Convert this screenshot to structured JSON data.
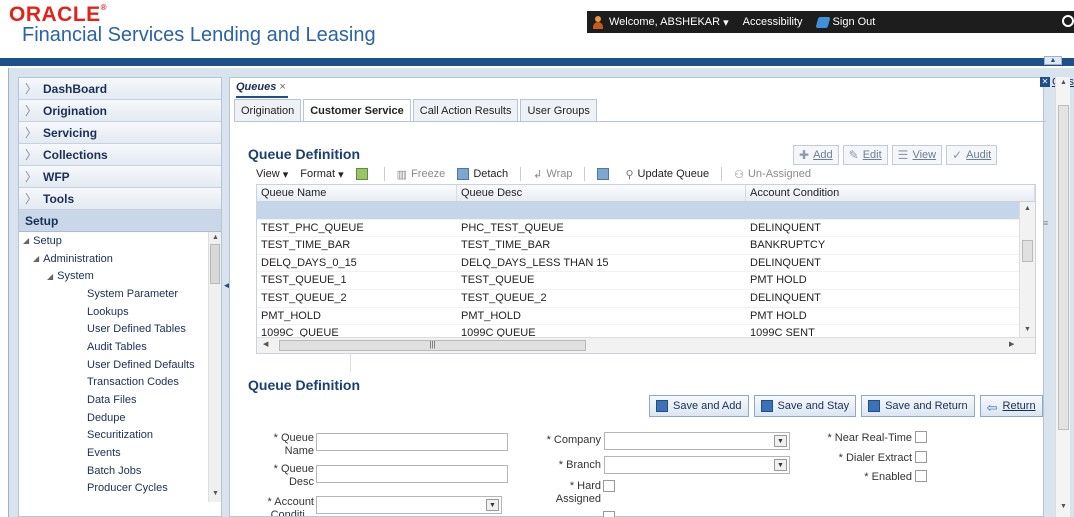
{
  "header": {
    "brand": "ORACLE",
    "product": "Financial Services Lending and Leasing",
    "welcome": "Welcome, ABSHEKAR",
    "accessibility": "Accessibility",
    "sign_out": "Sign Out"
  },
  "sidebar": {
    "items": [
      {
        "label": "DashBoard"
      },
      {
        "label": "Origination"
      },
      {
        "label": "Servicing"
      },
      {
        "label": "Collections"
      },
      {
        "label": "WFP"
      },
      {
        "label": "Tools"
      }
    ],
    "setup_header": "Setup",
    "tree": [
      {
        "label": "Setup",
        "level": 0,
        "expanded": true
      },
      {
        "label": "Administration",
        "level": 1,
        "expanded": true
      },
      {
        "label": "System",
        "level": 2,
        "expanded": true
      },
      {
        "label": "System Parameter",
        "level": 3
      },
      {
        "label": "Lookups",
        "level": 3
      },
      {
        "label": "User Defined Tables",
        "level": 3
      },
      {
        "label": "Audit Tables",
        "level": 3
      },
      {
        "label": "User Defined Defaults",
        "level": 3
      },
      {
        "label": "Transaction Codes",
        "level": 3
      },
      {
        "label": "Data Files",
        "level": 3
      },
      {
        "label": "Dedupe",
        "level": 3
      },
      {
        "label": "Securitization",
        "level": 3
      },
      {
        "label": "Events",
        "level": 3
      },
      {
        "label": "Batch Jobs",
        "level": 3
      },
      {
        "label": "Producer Cycles",
        "level": 3
      }
    ]
  },
  "main": {
    "tab_label": "Queues",
    "close_label": "Close",
    "subtabs": [
      {
        "label": "Origination",
        "active": false
      },
      {
        "label": "Customer Service",
        "active": true
      },
      {
        "label": "Call Action Results",
        "active": false
      },
      {
        "label": "User Groups",
        "active": false
      }
    ],
    "queue_definition_title": "Queue Definition",
    "record_buttons": {
      "add": "Add",
      "edit": "Edit",
      "view": "View",
      "audit": "Audit"
    },
    "toolbar": {
      "view": "View",
      "format": "Format",
      "freeze": "Freeze",
      "detach": "Detach",
      "wrap": "Wrap",
      "update_queue": "Update Queue",
      "un_assigned": "Un-Assigned"
    },
    "grid": {
      "columns": [
        "Queue Name",
        "Queue Desc",
        "Account Condition"
      ],
      "rows": [
        [
          "",
          "",
          ""
        ],
        [
          "TEST_PHC_QUEUE",
          "PHC_TEST_QUEUE",
          "DELINQUENT"
        ],
        [
          "TEST_TIME_BAR",
          "TEST_TIME_BAR",
          "BANKRUPTCY"
        ],
        [
          "DELQ_DAYS_0_15",
          "DELQ_DAYS_LESS THAN 15",
          "DELINQUENT"
        ],
        [
          "TEST_QUEUE_1",
          "TEST_QUEUE",
          "PMT HOLD"
        ],
        [
          "TEST_QUEUE_2",
          "TEST_QUEUE_2",
          "DELINQUENT"
        ],
        [
          "PMT_HOLD",
          "PMT_HOLD",
          "PMT HOLD"
        ],
        [
          "1099C_QUEUE",
          "1099C QUEUE",
          "1099C SENT"
        ]
      ],
      "selected_row": 0
    },
    "form": {
      "title": "Queue Definition",
      "buttons": {
        "save_add": "Save and Add",
        "save_stay": "Save and Stay",
        "save_return": "Save and Return",
        "return": "Return"
      },
      "labels": {
        "queue_name": "* Queue Name",
        "queue_desc": "* Queue Desc",
        "account_condition": "* Account Conditi...",
        "company": "* Company",
        "branch": "* Branch",
        "hard_assigned": "* Hard Assigned",
        "near_real_time": "* Near Real-Time",
        "dialer_extract": "* Dialer Extract",
        "enabled": "* Enabled"
      },
      "values": {
        "queue_name": "",
        "queue_desc": "",
        "account_condition": "",
        "company": "",
        "branch": ""
      },
      "checks": {
        "hard_assigned": false,
        "near_real_time": false,
        "dialer_extract": false,
        "enabled": false
      }
    }
  }
}
